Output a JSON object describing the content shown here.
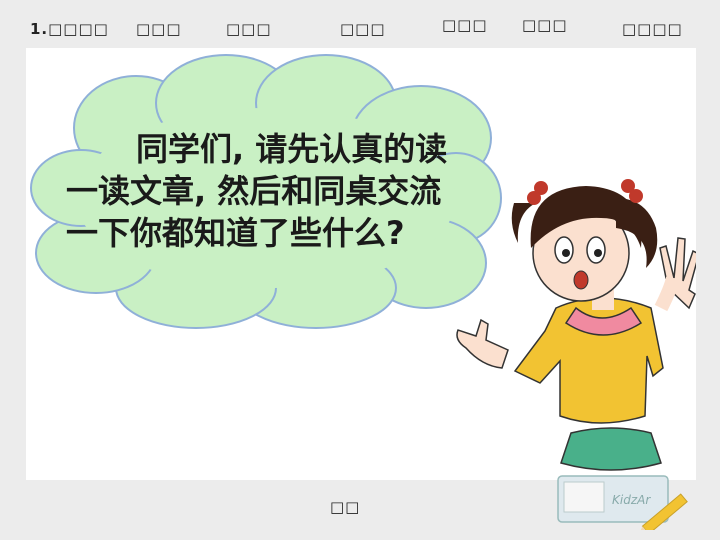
{
  "top_labels": [
    "1.□□□□",
    "□□□",
    "□□□",
    "□□□",
    "□□□",
    "□□□",
    "□□□□"
  ],
  "speech_bubble": {
    "line1": "同学们, 请先认真的读",
    "line2": "一读文章, 然后和同桌交流",
    "line3": "一下你都知道了些什么?"
  },
  "bottom_label": "□□",
  "deco_logo_text": "KidzAr",
  "colors": {
    "cloud_fill": "#c9f0c4",
    "cloud_stroke": "#8fb0d8",
    "shirt": "#f2c332",
    "collar": "#f08aa0",
    "skirt": "#49b08a",
    "hair": "#3a1f14",
    "skin": "#fbe0cf"
  }
}
